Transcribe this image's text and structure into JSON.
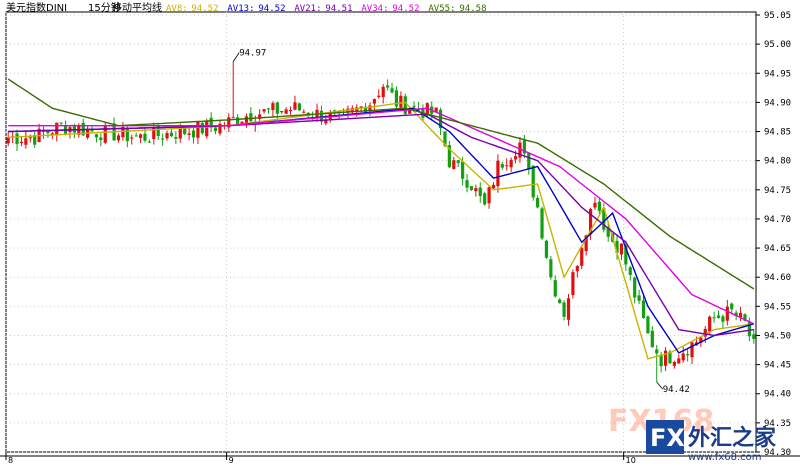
{
  "chart_data": {
    "type": "candlestick",
    "title": "美元指数DINI",
    "period": "15分钟",
    "indicator_name": "移动平均线",
    "ma_legend": [
      {
        "label": "AV8:",
        "value": "94.52",
        "color": "#c8b400"
      },
      {
        "label": "AV13:",
        "value": "94.52",
        "color": "#0000cc"
      },
      {
        "label": "AV21:",
        "value": "94.51",
        "color": "#7a00a8"
      },
      {
        "label": "AV34:",
        "value": "94.52",
        "color": "#e000e0"
      },
      {
        "label": "AV55:",
        "value": "94.58",
        "color": "#3a6b00"
      }
    ],
    "ylim": [
      94.3,
      95.05
    ],
    "y_ticks": [
      "95.05",
      "95.00",
      "94.95",
      "94.90",
      "94.85",
      "94.80",
      "94.75",
      "94.70",
      "94.65",
      "94.60",
      "94.55",
      "94.50",
      "94.45",
      "94.40",
      "94.35",
      "94.30"
    ],
    "x_ticks": [
      {
        "label": "8",
        "index": 0
      },
      {
        "label": "9",
        "index": 50
      },
      {
        "label": "10",
        "index": 140
      }
    ],
    "annotations": [
      {
        "text": "94.97",
        "index": 51,
        "value": 94.97
      },
      {
        "text": "94.42",
        "index": 147,
        "value": 94.42
      }
    ],
    "candles_count": 170,
    "key_closes": [
      [
        0,
        94.84
      ],
      [
        6,
        94.84
      ],
      [
        12,
        94.86
      ],
      [
        20,
        94.85
      ],
      [
        30,
        94.84
      ],
      [
        40,
        94.85
      ],
      [
        48,
        94.86
      ],
      [
        51,
        94.87
      ],
      [
        55,
        94.88
      ],
      [
        65,
        94.89
      ],
      [
        75,
        94.87
      ],
      [
        82,
        94.9
      ],
      [
        85,
        94.93
      ],
      [
        88,
        94.9
      ],
      [
        92,
        94.89
      ],
      [
        97,
        94.88
      ],
      [
        100,
        94.8
      ],
      [
        105,
        94.76
      ],
      [
        108,
        94.72
      ],
      [
        111,
        94.79
      ],
      [
        116,
        94.83
      ],
      [
        120,
        94.72
      ],
      [
        123,
        94.6
      ],
      [
        126,
        94.54
      ],
      [
        130,
        94.66
      ],
      [
        133,
        94.74
      ],
      [
        136,
        94.67
      ],
      [
        139,
        94.65
      ],
      [
        142,
        94.57
      ],
      [
        145,
        94.5
      ],
      [
        148,
        94.46
      ],
      [
        152,
        94.47
      ],
      [
        156,
        94.49
      ],
      [
        160,
        94.53
      ],
      [
        164,
        94.54
      ],
      [
        167,
        94.52
      ],
      [
        169,
        94.48
      ]
    ],
    "ma_anchors": {
      "AV8": [
        [
          0,
          94.84
        ],
        [
          50,
          94.86
        ],
        [
          90,
          94.9
        ],
        [
          100,
          94.82
        ],
        [
          110,
          94.75
        ],
        [
          120,
          94.76
        ],
        [
          126,
          94.6
        ],
        [
          135,
          94.72
        ],
        [
          145,
          94.46
        ],
        [
          150,
          94.47
        ],
        [
          160,
          94.51
        ],
        [
          169,
          94.52
        ]
      ],
      "AV13": [
        [
          0,
          94.85
        ],
        [
          50,
          94.86
        ],
        [
          92,
          94.89
        ],
        [
          100,
          94.85
        ],
        [
          110,
          94.77
        ],
        [
          120,
          94.79
        ],
        [
          130,
          94.66
        ],
        [
          137,
          94.71
        ],
        [
          145,
          94.55
        ],
        [
          152,
          94.47
        ],
        [
          160,
          94.5
        ],
        [
          169,
          94.52
        ]
      ],
      "AV21": [
        [
          0,
          94.85
        ],
        [
          50,
          94.86
        ],
        [
          95,
          94.88
        ],
        [
          105,
          94.84
        ],
        [
          120,
          94.8
        ],
        [
          130,
          94.72
        ],
        [
          140,
          94.66
        ],
        [
          152,
          94.51
        ],
        [
          160,
          94.5
        ],
        [
          169,
          94.51
        ]
      ],
      "AV34": [
        [
          0,
          94.86
        ],
        [
          50,
          94.86
        ],
        [
          95,
          94.89
        ],
        [
          110,
          94.84
        ],
        [
          125,
          94.79
        ],
        [
          140,
          94.7
        ],
        [
          155,
          94.57
        ],
        [
          169,
          94.52
        ]
      ],
      "AV55": [
        [
          0,
          94.94
        ],
        [
          10,
          94.89
        ],
        [
          25,
          94.86
        ],
        [
          50,
          94.87
        ],
        [
          90,
          94.89
        ],
        [
          105,
          94.86
        ],
        [
          120,
          94.83
        ],
        [
          135,
          94.76
        ],
        [
          150,
          94.67
        ],
        [
          169,
          94.58
        ]
      ]
    }
  },
  "watermark": {
    "brand": "FX168",
    "site_name": "外汇之家",
    "url": "www.fx68.com"
  }
}
